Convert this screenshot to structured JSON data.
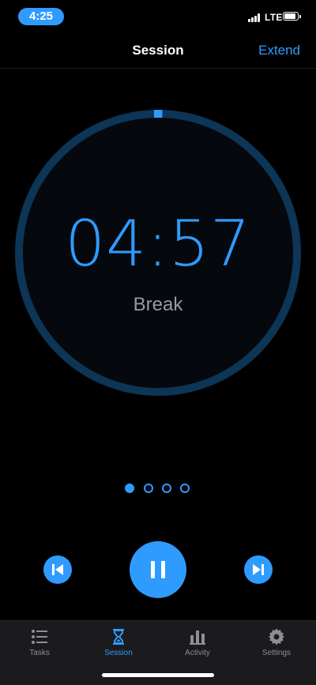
{
  "status_bar": {
    "time": "4:25",
    "network": "LTE",
    "icons": [
      "signal-icon",
      "battery-icon"
    ]
  },
  "nav": {
    "title": "Session",
    "action_label": "Extend"
  },
  "timer": {
    "display": "04:57",
    "phase": "Break",
    "progress_remaining_fraction": 0.99
  },
  "pager": {
    "count": 4,
    "active_index": 0
  },
  "controls": {
    "icons": [
      "skip-back-icon",
      "pause-icon",
      "skip-forward-icon"
    ]
  },
  "tabs": [
    {
      "label": "Tasks",
      "icon": "list-icon",
      "active": false
    },
    {
      "label": "Session",
      "icon": "hourglass-icon",
      "active": true
    },
    {
      "label": "Activity",
      "icon": "bar-chart-icon",
      "active": false
    },
    {
      "label": "Settings",
      "icon": "gear-icon",
      "active": false
    }
  ],
  "colors": {
    "accent": "#2f9bff",
    "ring_track": "#0d3556",
    "background": "#000000",
    "tab_bar": "#1b1b1d",
    "muted_text": "#9a9aa0"
  }
}
